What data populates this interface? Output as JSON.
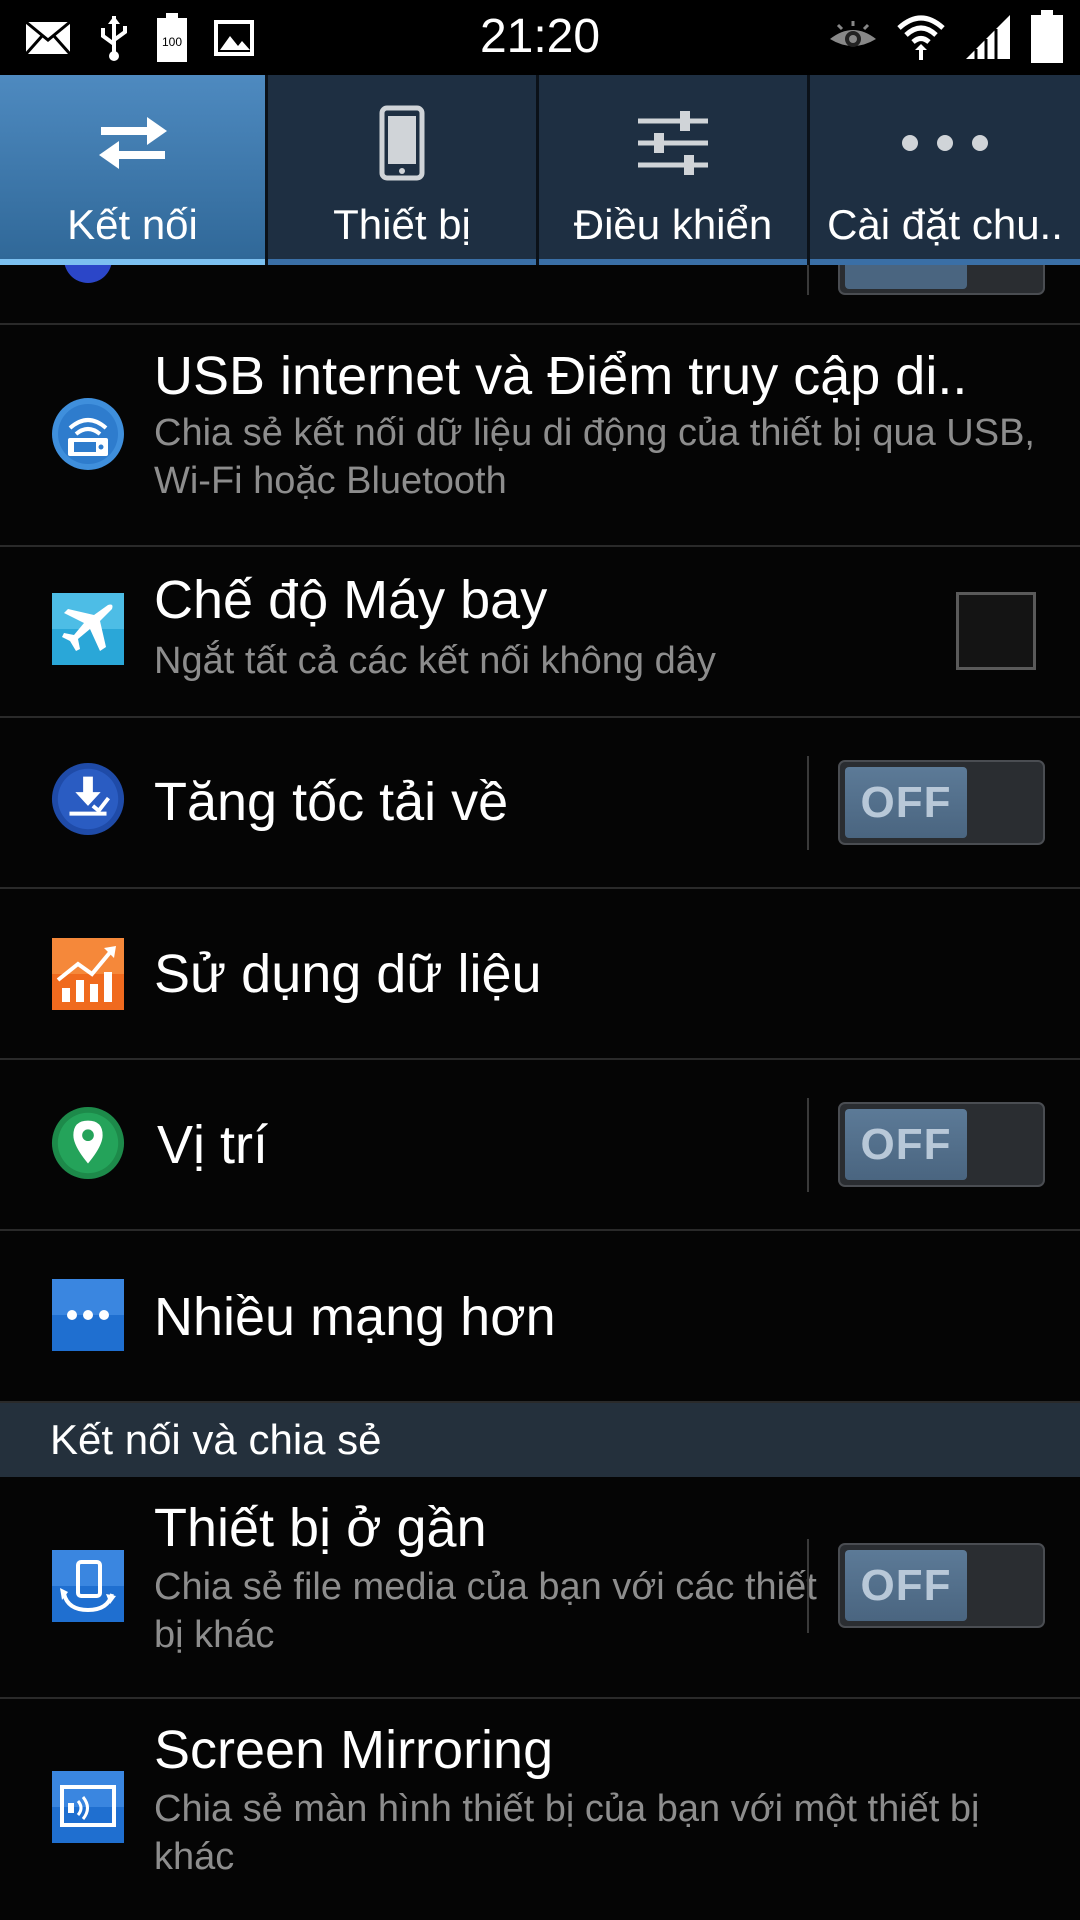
{
  "status_bar": {
    "time": "21:20",
    "battery_level": "100",
    "left_icons": [
      "email-icon",
      "usb-icon",
      "battery-full-icon",
      "gallery-icon"
    ],
    "right_icons": [
      "smart-stay-eye-icon",
      "wifi-icon",
      "signal-icon",
      "battery-icon"
    ]
  },
  "tabs": [
    {
      "label": "Kết nối",
      "icon": "transfer-arrows-icon",
      "active": true
    },
    {
      "label": "Thiết bị",
      "icon": "phone-device-icon",
      "active": false
    },
    {
      "label": "Điều khiển",
      "icon": "sliders-icon",
      "active": false
    },
    {
      "label": "Cài đặt chu..",
      "icon": "more-dots-icon",
      "active": false
    }
  ],
  "rows": {
    "tethering": {
      "title": "USB internet và Điểm truy cập di..",
      "subtitle": "Chia sẻ kết nối dữ liệu di động của thiết bị qua USB, Wi-Fi hoặc Bluetooth",
      "icon": "hotspot-icon"
    },
    "airplane": {
      "title": "Chế độ Máy bay",
      "subtitle": "Ngắt tất cả các kết nối không dây",
      "icon": "airplane-icon",
      "checked": false
    },
    "download_booster": {
      "title": "Tăng tốc tải về",
      "icon": "download-booster-icon",
      "toggle": "OFF"
    },
    "data_usage": {
      "title": "Sử dụng dữ liệu",
      "icon": "data-usage-icon"
    },
    "location": {
      "title": "Vị trí",
      "icon": "location-pin-icon",
      "toggle": "OFF"
    },
    "more_networks": {
      "title": "Nhiều mạng hơn",
      "icon": "more-networks-icon"
    },
    "nearby_devices": {
      "title": "Thiết bị ở gần",
      "subtitle": "Chia sẻ file media của bạn với các thiết bị khác",
      "icon": "nearby-devices-icon",
      "toggle": "OFF"
    },
    "screen_mirroring": {
      "title": "Screen Mirroring",
      "subtitle": "Chia sẻ màn hình thiết bị của bạn với một thiết bị khác",
      "icon": "screen-mirroring-icon"
    }
  },
  "section_header": {
    "label": "Kết nối và chia sẻ"
  },
  "colors": {
    "tab_active": "#4e8ac0",
    "tab_inactive": "#1e2f42",
    "toggle_knob": "#4a6580",
    "section_header": "#24303c",
    "subtitle": "#8d8d8d"
  }
}
